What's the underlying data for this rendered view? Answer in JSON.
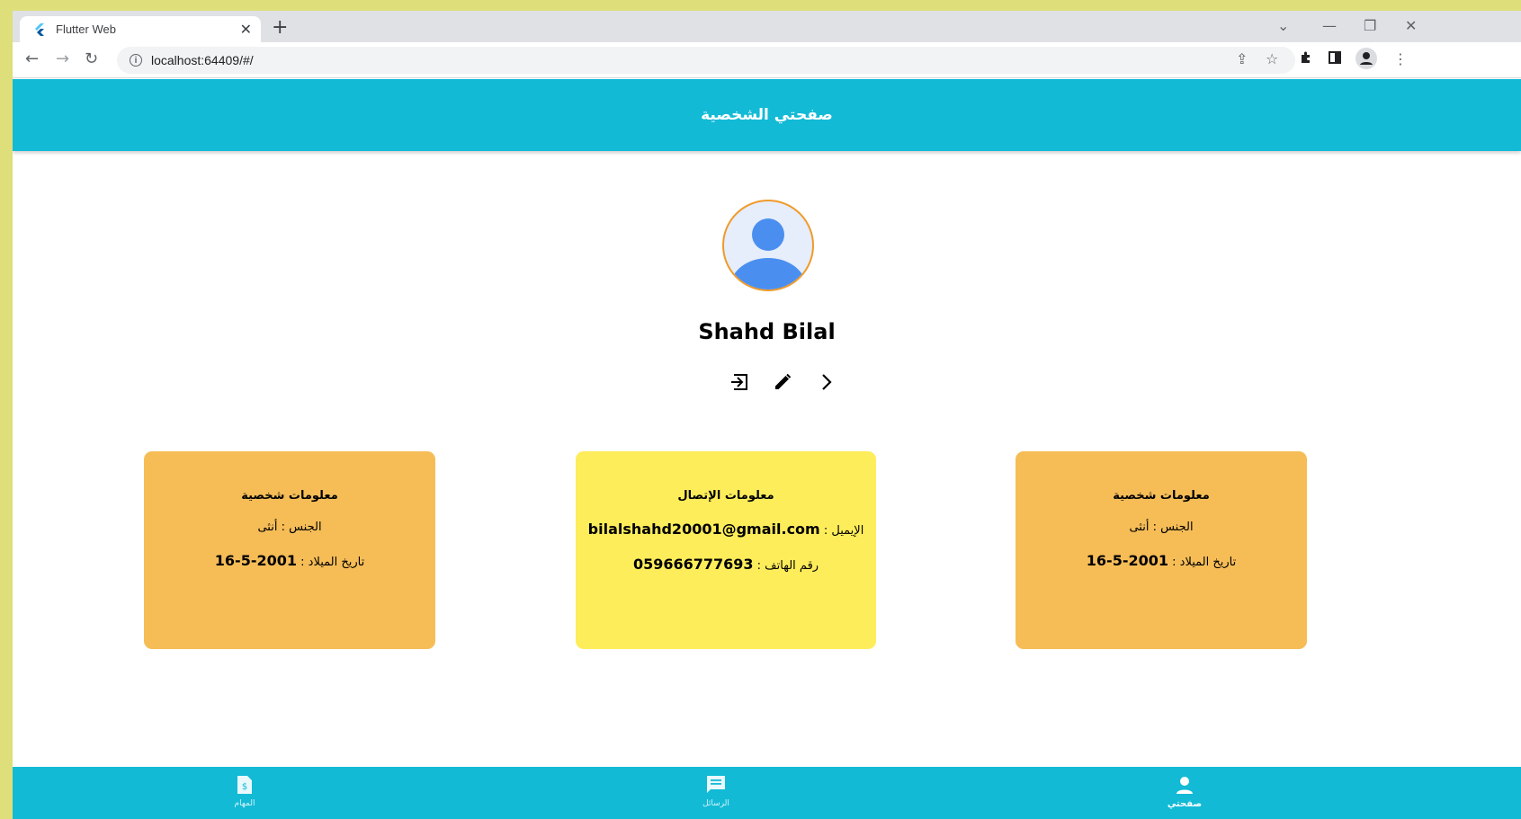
{
  "browser": {
    "tab_title": "Flutter Web",
    "url": "localhost:64409/#/"
  },
  "app": {
    "title": "صفحتي الشخصية",
    "user_name": "Shahd Bilal",
    "cards": {
      "left": {
        "title": "معلومات شخصية",
        "gender_label": "الجنس :",
        "gender_value": "أنثى",
        "birth_label": "تاريخ الميلاد :",
        "birth_value": "16-5-2001"
      },
      "center": {
        "title": "معلومات الإتصال",
        "email_label": "الإيميل :",
        "email_value": "bilalshahd20001@gmail.com",
        "phone_label": "رقم الهاتف :",
        "phone_value": "059666777693"
      },
      "right": {
        "title": "معلومات شخصية",
        "gender_label": "الجنس :",
        "gender_value": "أنثى",
        "birth_label": "تاريخ الميلاد :",
        "birth_value": "16-5-2001"
      }
    },
    "bottom_nav": {
      "tasks": "المهام",
      "messages": "الرسائل",
      "profile": "صفحتي"
    }
  },
  "icons": [
    "flutter-favicon",
    "back-icon",
    "forward-icon",
    "reload-icon",
    "info-icon",
    "share-icon",
    "star-icon",
    "extensions-icon",
    "sidepanel-icon",
    "profile-icon",
    "menu-icon",
    "logout-icon",
    "edit-icon",
    "chevron-right-icon",
    "tasks-icon",
    "messages-icon",
    "person-icon"
  ],
  "colors": {
    "primary": "#12bad6",
    "orange_card": "#f6bd57",
    "yellow_card": "#feed5a",
    "avatar_border": "#f09a2a",
    "avatar_fill": "#4a8ff0"
  }
}
